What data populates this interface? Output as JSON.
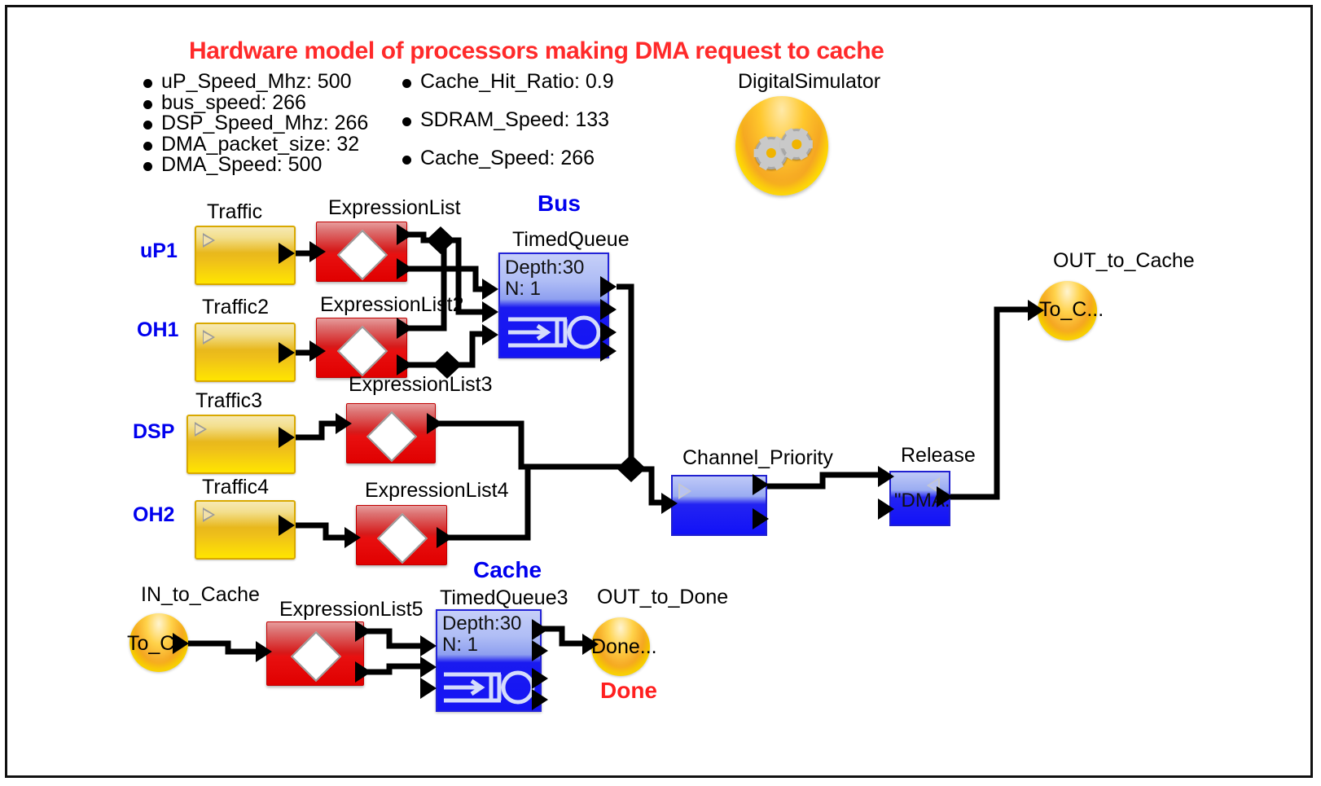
{
  "title": "Hardware model of processors making DMA request to cache",
  "colors": {
    "title_red": "#FF2A2A",
    "label_blue": "#0000EE",
    "traffic_yellow": "#E8B81C",
    "expression_red": "#D61A1A",
    "queue_blue": "#1A1AF0",
    "wire_black": "#000000"
  },
  "parameters": {
    "column_left": [
      "uP_Speed_Mhz: 500",
      "bus_speed: 266",
      "DSP_Speed_Mhz: 266",
      "DMA_packet_size: 32",
      "DMA_Speed: 500"
    ],
    "column_right": [
      "Cache_Hit_Ratio: 0.9",
      "SDRAM_Speed: 133",
      "Cache_Speed: 266"
    ]
  },
  "simulator": {
    "label": "DigitalSimulator",
    "icon": "gears-icon"
  },
  "group_labels": {
    "bus": "Bus",
    "cache": "Cache"
  },
  "source_labels": {
    "up1": "uP1",
    "oh1": "OH1",
    "dsp": "DSP",
    "oh2": "OH2"
  },
  "blocks": {
    "traffic1": {
      "title": "Traffic"
    },
    "traffic2": {
      "title": "Traffic2"
    },
    "traffic3": {
      "title": "Traffic3"
    },
    "traffic4": {
      "title": "Traffic4"
    },
    "expr1": {
      "title": "ExpressionList"
    },
    "expr2": {
      "title": "ExpressionList2"
    },
    "expr3": {
      "title": "ExpressionList3"
    },
    "expr4": {
      "title": "ExpressionList4"
    },
    "expr5": {
      "title": "ExpressionList5"
    },
    "bus_queue": {
      "title": "TimedQueue",
      "depth": "Depth:30",
      "n": "N: 1"
    },
    "cache_queue": {
      "title": "TimedQueue3",
      "depth": "Depth:30",
      "n": "N: 1"
    },
    "channel_priority": {
      "title": "Channel_Priority"
    },
    "release": {
      "title": "Release",
      "value": "\"DMA."
    }
  },
  "terminals": {
    "out_to_cache": {
      "title": "OUT_to_Cache",
      "text": "To_C..."
    },
    "in_to_cache": {
      "title": "IN_to_Cache",
      "text": "To_C."
    },
    "out_to_done": {
      "title": "OUT_to_Done",
      "text": "Done...",
      "caption": "Done"
    }
  }
}
